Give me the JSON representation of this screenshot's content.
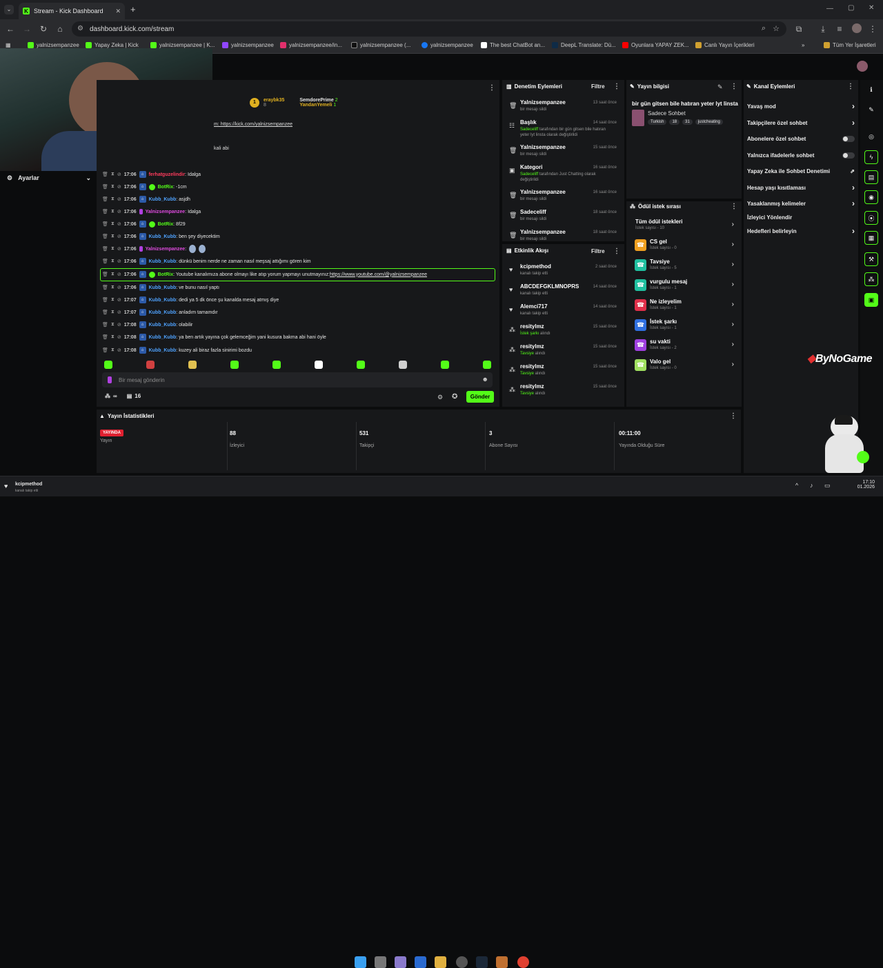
{
  "browser": {
    "tab_title": "Stream - Kick Dashboard",
    "url": "dashboard.kick.com/stream",
    "bookmarks": [
      "yalnizsempanzee",
      "Yapay Zeka | Kick",
      "yalnizsempanzee | K...",
      "yalnizsempanzee",
      "yalnizsempanzee/in...",
      "yalnizsempanzee (...",
      "yalnizsempanzee",
      "The best ChatBot an...",
      "DeepL Translate: Dü...",
      "Oyunlara YAPAY ZEK...",
      "Canlı Yayın İçerikleri"
    ],
    "all_bookmarks": "Tüm Yer İşaretleri"
  },
  "sidebar": {
    "settings_label": "Ayarlar"
  },
  "chat": {
    "pinned_top": {
      "user1": "eraybk35",
      "user1_count": "8",
      "user2": "SemdorePrime",
      "user2_count": "2",
      "user3": "YandanYemeli",
      "user3_count": "1"
    },
    "partial_link": "m: https://kick.com/yalnizsempanzee",
    "partial_text": "kali abi",
    "messages": [
      {
        "time": "17:06",
        "user": "ferhatguzelindir",
        "color": "#ff3b5c",
        "text": ": Idalga",
        "bot": false
      },
      {
        "time": "17:06",
        "user": "BotRix",
        "color": "#53fc18",
        "text": ": -1cm",
        "bot": true
      },
      {
        "time": "17:06",
        "user": "Kubb_Kubb",
        "color": "#4fa3ff",
        "text": ": asjdh",
        "bot": false
      },
      {
        "time": "17:06",
        "user": "Yalnizsempanzee",
        "color": "#e04be0",
        "text": ": Idalga",
        "bot": false
      },
      {
        "time": "17:06",
        "user": "BotRix",
        "color": "#53fc18",
        "text": ": 8f29",
        "bot": true
      },
      {
        "time": "17:06",
        "user": "Kubb_Kubb",
        "color": "#4fa3ff",
        "text": ": ben şey diyecektim",
        "bot": false
      },
      {
        "time": "17:06",
        "user": "Yalnizsempanzee",
        "color": "#e04be0",
        "text": ":",
        "bot": false
      },
      {
        "time": "17:06",
        "user": "Kubb_Kubb",
        "color": "#4fa3ff",
        "text": ": dünkü benim nerde ne zaman nasıl meşsaj attığımı gören kim",
        "bot": false
      },
      {
        "time": "17:06",
        "user": "BotRix",
        "color": "#53fc18",
        "text": ": Youtube kanalımıza abone olmayı like atıp yorum yapmayı unutmayınız: ",
        "link": "https://www.youtube.com/@yalnizsempanzee",
        "bot": true
      },
      {
        "time": "17:06",
        "user": "Kubb_Kubb",
        "color": "#4fa3ff",
        "text": ": ve bunu nasıl yaptı",
        "bot": false
      },
      {
        "time": "17:07",
        "user": "Kubb_Kubb",
        "color": "#4fa3ff",
        "text": ": dedi ya 5 dk önce şu kanalda mesaj atmış diye",
        "bot": false
      },
      {
        "time": "17:07",
        "user": "Kubb_Kubb",
        "color": "#4fa3ff",
        "text": ": anladım tamamdır",
        "bot": false
      },
      {
        "time": "17:08",
        "user": "Kubb_Kubb",
        "color": "#4fa3ff",
        "text": ": olabilir",
        "bot": false
      },
      {
        "time": "17:08",
        "user": "Kubb_Kubb",
        "color": "#4fa3ff",
        "text": ": ya ben artık yayına çok gelemceğim yani kusura bakma abi hani öyle",
        "bot": false
      },
      {
        "time": "17:08",
        "user": "Kubb_Kubb",
        "color": "#4fa3ff",
        "text": ": kuzey ali biraz fazla sinirimi bozdu",
        "bot": false
      }
    ],
    "input_placeholder": "Bir mesaj gönderin",
    "viewer_count": "16",
    "send_label": "Gönder"
  },
  "moderation": {
    "title": "Denetim Eylemleri",
    "filter": "Filtre",
    "items": [
      {
        "icon": "trash",
        "title": "Yalnizsempanzee",
        "desc": "bir mesajı sildi",
        "time": "13 saat önce"
      },
      {
        "icon": "user",
        "title": "Başlık",
        "desc_green": "Sadeceliff",
        "desc": " tarafından bir gün gitsen bile hatıran yeter lyt linsta olarak değiştirildi",
        "time": "14 saat önce"
      },
      {
        "icon": "trash",
        "title": "Yalnizsempanzee",
        "desc": "bir mesajı sildi",
        "time": "15 saat önce"
      },
      {
        "icon": "category",
        "title": "Kategori",
        "desc_green": "Sadeceliff",
        "desc": " tarafından Just Chatting olarak değiştirildi",
        "time": "16 saat önce"
      },
      {
        "icon": "trash",
        "title": "Yalnizsempanzee",
        "desc": "bir mesajı sildi",
        "time": "16 saat önce"
      },
      {
        "icon": "trash",
        "title": "Sadeceliff",
        "desc": "bir mesajı sildi",
        "time": "18 saat önce"
      },
      {
        "icon": "trash",
        "title": "Yalnizsempanzee",
        "desc": "bir mesajı sildi",
        "time": "18 saat önce"
      }
    ]
  },
  "activity": {
    "title": "Etkinlik Akışı",
    "filter": "Filtre",
    "items": [
      {
        "icon": "heart",
        "title": "kcipmethod",
        "desc": "kanalı takip etti",
        "time": "2 saat önce"
      },
      {
        "icon": "heart",
        "title": "ABCDEFGKLMNOPRS",
        "desc": "kanalı takip etti",
        "time": "14 saat önce"
      },
      {
        "icon": "heart",
        "title": "Alemci717",
        "desc": "kanalı takip etti",
        "time": "14 saat önce"
      },
      {
        "icon": "reward",
        "title": "resitylmz",
        "desc_green": "İstek şarkı",
        "desc": " alındı",
        "time": "15 saat önce"
      },
      {
        "icon": "reward",
        "title": "resitylmz",
        "desc_green": "Tavsiye",
        "desc": " alındı",
        "time": "15 saat önce"
      },
      {
        "icon": "reward",
        "title": "resitylmz",
        "desc_green": "Tavsiye",
        "desc": " alındı",
        "time": "15 saat önce"
      },
      {
        "icon": "reward",
        "title": "resitylmz",
        "desc_green": "Tavsiye",
        "desc": " alındı",
        "time": "15 saat önce"
      }
    ]
  },
  "stream_info": {
    "title": "Yayın bilgisi",
    "stream_title": "bir gün gitsen bile hatıran yeter lyt linsta",
    "category": "Sadece Sohbet",
    "tags": [
      "Turkish",
      "18",
      "31",
      "justcheating"
    ]
  },
  "rewards": {
    "title": "Ödül istek sırası",
    "all_label": "Tüm ödül istekleri",
    "all_count": "İstek sayısı - 10",
    "items": [
      {
        "name": "CS gel",
        "count": "İstek sayısı - 0",
        "color": "#f0a020"
      },
      {
        "name": "Tavsiye",
        "count": "İstek sayısı - 5",
        "color": "#20c0a0"
      },
      {
        "name": "vurgulu mesaj",
        "count": "İstek sayısı - 1",
        "color": "#20c0a0"
      },
      {
        "name": "Ne izleyelim",
        "count": "İstek sayısı - 1",
        "color": "#e0304a"
      },
      {
        "name": "İstek şarkı",
        "count": "İstek sayısı - 1",
        "color": "#3070e0"
      },
      {
        "name": "su vakti",
        "count": "İstek sayısı - 2",
        "color": "#a040e0"
      },
      {
        "name": "Valo gel",
        "count": "İstek sayısı - 0",
        "color": "#a0e060"
      }
    ]
  },
  "channel_actions": {
    "title": "Kanal Eylemleri",
    "items": [
      {
        "label": "Yavaş mod",
        "kind": "chevron"
      },
      {
        "label": "Takipçilere özel sohbet",
        "kind": "chevron"
      },
      {
        "label": "Abonelere özel sohbet",
        "kind": "toggle"
      },
      {
        "label": "Yalnızca ifadelerle sohbet",
        "kind": "toggle"
      },
      {
        "label": "Yapay Zeka ile Sohbet Denetimi",
        "kind": "external"
      },
      {
        "label": "Hesap yaşı kısıtlaması",
        "kind": "chevron"
      },
      {
        "label": "Yasaklanmış kelimeler",
        "kind": "chevron"
      },
      {
        "label": "İzleyici Yönlendir",
        "kind": "none"
      },
      {
        "label": "Hedefleri belirleyin",
        "kind": "chevron"
      }
    ]
  },
  "stats": {
    "title": "Yayın İstatistikleri",
    "live_badge": "YAYINDA",
    "cols": [
      {
        "value": "",
        "label": "Yayın"
      },
      {
        "value": "88",
        "label": "İzleyici"
      },
      {
        "value": "531",
        "label": "Takipçi"
      },
      {
        "value": "3",
        "label": "Abone Sayısı"
      },
      {
        "value": "00:11:00",
        "label": "Yayında Olduğu Süre"
      }
    ]
  },
  "watermark": "ByNoGame",
  "notification": {
    "user": "kcipmethod",
    "text": "kanalı takip etti"
  },
  "clock": {
    "time": "17:10",
    "date": "01.2026"
  },
  "colors": {
    "accent": "#53fc18",
    "panel": "#17181a",
    "background": "#0b0c0d"
  }
}
